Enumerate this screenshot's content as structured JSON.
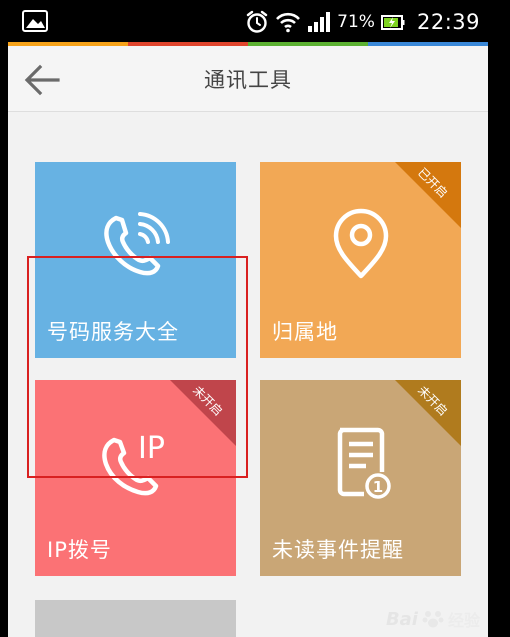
{
  "status_bar": {
    "battery_percent": "71%",
    "time": "22:39",
    "icons": [
      "gallery-icon",
      "alarm-icon",
      "wifi-icon",
      "signal-icon",
      "battery-icon"
    ]
  },
  "accent_colors": [
    "#f7a31a",
    "#e0452d",
    "#5cb132",
    "#3a88d8"
  ],
  "header": {
    "title": "通讯工具",
    "back_icon": "arrow-left-icon"
  },
  "tiles": [
    {
      "label": "号码服务大全",
      "color": "#67b2e3",
      "icon": "phone-signal-icon",
      "ribbon": ""
    },
    {
      "label": "归属地",
      "color": "#f2a855",
      "icon": "location-pin-icon",
      "ribbon": "已开启",
      "ribbon_color": "#d4780e"
    },
    {
      "label": "IP拨号",
      "color": "#fb7275",
      "icon": "phone-ip-icon",
      "ribbon": "未开启",
      "ribbon_color": "#c0454b"
    },
    {
      "label": "未读事件提醒",
      "color": "#c9a676",
      "icon": "document-badge-icon",
      "ribbon": "未开启",
      "ribbon_color": "#b07b1e",
      "badge": "1"
    },
    {
      "label": "",
      "color": "#c8c8c8",
      "icon": "",
      "ribbon": ""
    }
  ],
  "ip_icon_text": "IP",
  "watermark": {
    "brand": "Bai",
    "suffix": "经验"
  }
}
